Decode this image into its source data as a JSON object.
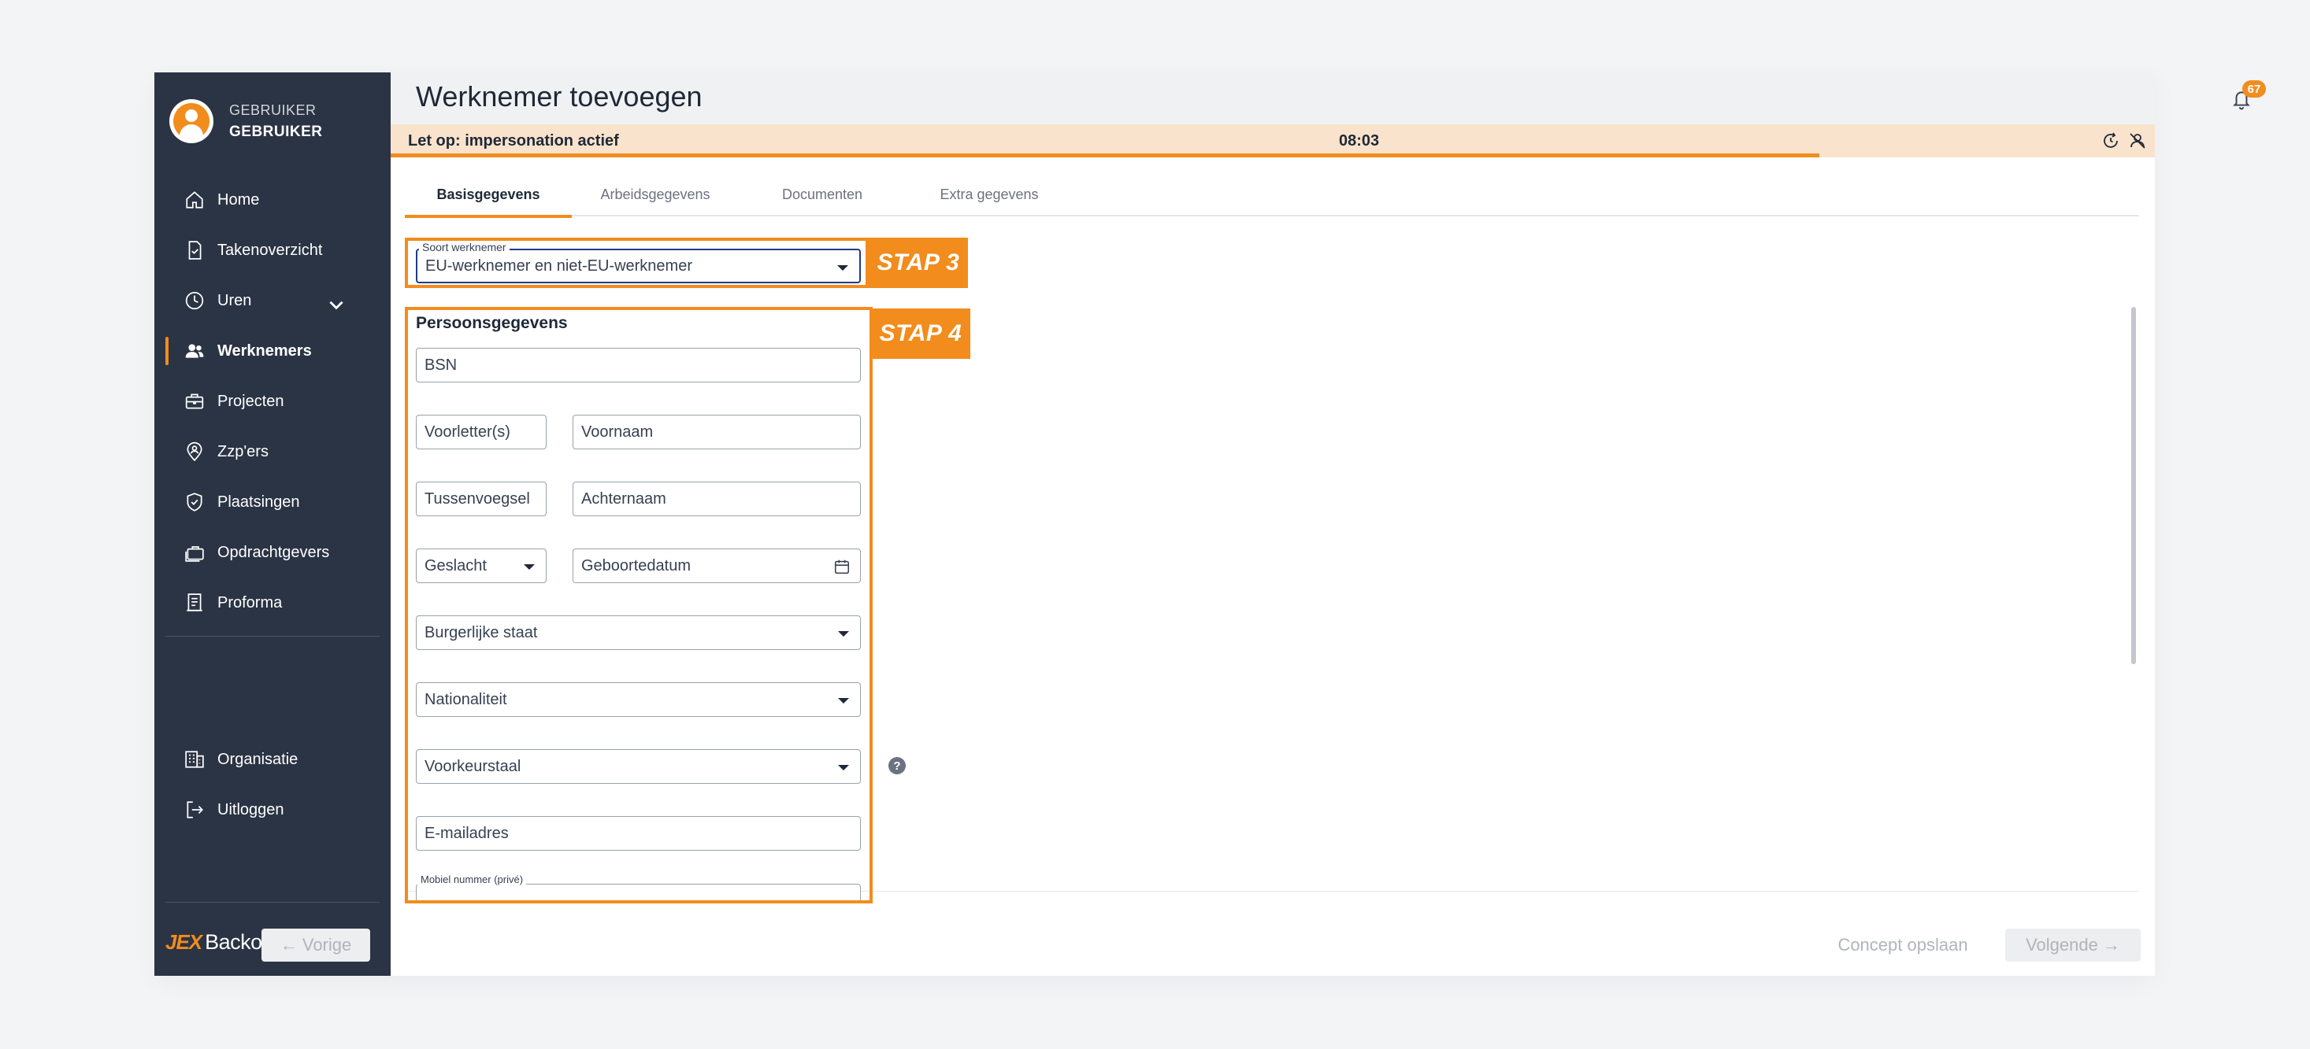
{
  "user": {
    "role": "GEBRUIKER",
    "name": "GEBRUIKER"
  },
  "nav": {
    "items": [
      {
        "label": "Home",
        "icon": "home-icon"
      },
      {
        "label": "Takenoverzicht",
        "icon": "task-icon"
      },
      {
        "label": "Uren",
        "icon": "clock-icon"
      },
      {
        "label": "Werknemers",
        "icon": "users-icon",
        "active": true
      },
      {
        "label": "Projecten",
        "icon": "briefcase-icon"
      },
      {
        "label": "Zzp'ers",
        "icon": "location-pin-icon"
      },
      {
        "label": "Plaatsingen",
        "icon": "shield-check-icon"
      },
      {
        "label": "Opdrachtgevers",
        "icon": "briefcases-icon"
      },
      {
        "label": "Proforma",
        "icon": "receipt-icon"
      }
    ],
    "secondary": [
      {
        "label": "Organisatie",
        "icon": "building-icon"
      },
      {
        "label": "Uitloggen",
        "icon": "logout-icon"
      }
    ]
  },
  "brand": {
    "logo": "JEX",
    "name": "Backoffice"
  },
  "header": {
    "title": "Werknemer toevoegen",
    "notification_count": "67"
  },
  "impersonation": {
    "label": "Let op: impersonation actief",
    "time": "08:03",
    "progress": 0.81
  },
  "tabs": [
    {
      "label": "Basisgegevens",
      "active": true
    },
    {
      "label": "Arbeidsgegevens"
    },
    {
      "label": "Documenten"
    },
    {
      "label": "Extra gegevens"
    }
  ],
  "annotations": {
    "step3": "STAP 3",
    "step4": "STAP 4"
  },
  "form": {
    "soort_werknemer": {
      "label": "Soort werknemer",
      "value": "EU-werknemer en niet-EU-werknemer"
    },
    "section_title": "Persoonsgegevens",
    "bsn": "BSN",
    "voorletters": "Voorletter(s)",
    "voornaam": "Voornaam",
    "tussenvoegsel": "Tussenvoegsel",
    "achternaam": "Achternaam",
    "geslacht": "Geslacht",
    "geboortedatum": "Geboortedatum",
    "burgerlijke_staat": "Burgerlijke staat",
    "nationaliteit": "Nationaliteit",
    "voorkeurstaal": "Voorkeurstaal",
    "help": "?",
    "email": "E-mailadres",
    "mobiel_label": "Mobiel nummer (privé)"
  },
  "footer": {
    "prev": "← Vorige",
    "concept": "Concept opslaan",
    "next": "Volgende →"
  },
  "colors": {
    "accent": "#f28c1d",
    "sidebar": "#2b3444",
    "impersonation_bg": "#fae3cc"
  }
}
